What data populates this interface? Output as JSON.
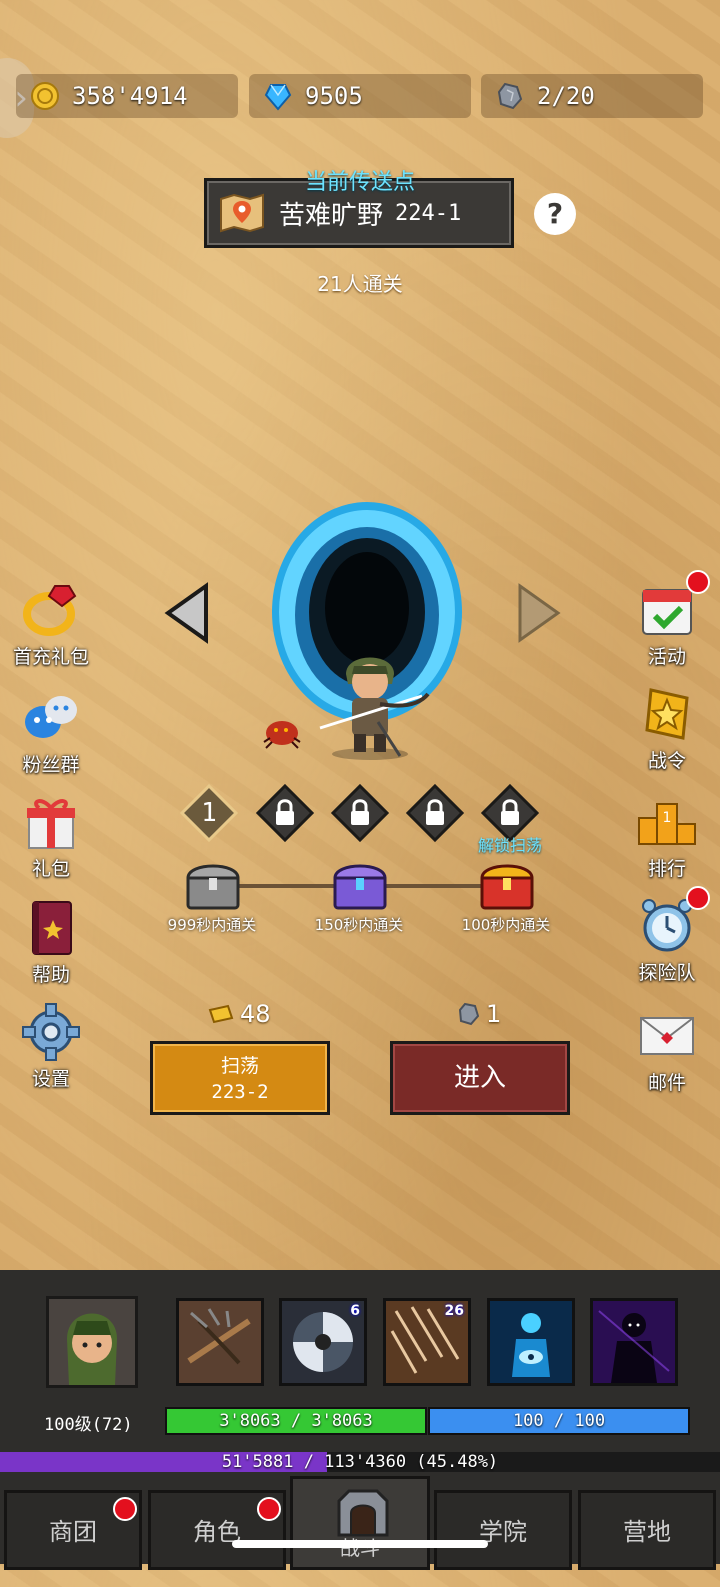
{
  "resources": {
    "gold": "358'4914",
    "gems": "9505",
    "stamina": "2/20"
  },
  "portal": {
    "title": "当前传送点",
    "location_name": "苦难旷野",
    "location_stage": "224-1",
    "cleared_count": "21人通关",
    "help_label": "?"
  },
  "left_menu": {
    "first_recharge": "首充礼包",
    "fan_group": "粉丝群",
    "gift": "礼包",
    "help": "帮助",
    "settings": "设置"
  },
  "right_menu": {
    "events": "活动",
    "battle_pass": "战令",
    "ranking": "排行",
    "expedition": "探险队",
    "mail": "邮件"
  },
  "stars": {
    "first": "1",
    "unlock_sweep": "解锁扫荡"
  },
  "chests": [
    {
      "label": "999秒内通关",
      "color": "#8a8a8a"
    },
    {
      "label": "150秒内通关",
      "color": "#7a5ad6"
    },
    {
      "label": "100秒内通关",
      "color": "#d8332a"
    }
  ],
  "actions": {
    "sweep_cost": "48",
    "enter_cost": "1",
    "sweep_label": "扫荡",
    "sweep_stage": "223-2",
    "enter_label": "进入"
  },
  "player": {
    "level": "100级(72)",
    "hp_text": "3'8063 / 3'8063",
    "hp_fraction": 1.0,
    "mp_text": "100 / 100",
    "mp_fraction": 1.0,
    "xp_text": "51'5881 / 113'4360 (45.48%)",
    "xp_fraction": 0.4548
  },
  "skills": [
    {
      "icon": "crossbow-icon",
      "badge": ""
    },
    {
      "icon": "spinning-blade-icon",
      "badge": "6"
    },
    {
      "icon": "arrow-rain-icon",
      "badge": "26"
    },
    {
      "icon": "spirit-eye-icon",
      "badge": ""
    },
    {
      "icon": "shadow-figure-icon",
      "badge": ""
    }
  ],
  "nav": {
    "guild": "商团",
    "character": "角色",
    "battle": "战斗",
    "academy": "学院",
    "camp": "营地"
  },
  "colors": {
    "hp": "#35c834",
    "mp": "#3b8ff0",
    "xp": "#7a35c8",
    "sweep_button": "#d48a13",
    "enter_button": "#7a2a27",
    "accent_cyan": "#6de3ff"
  }
}
